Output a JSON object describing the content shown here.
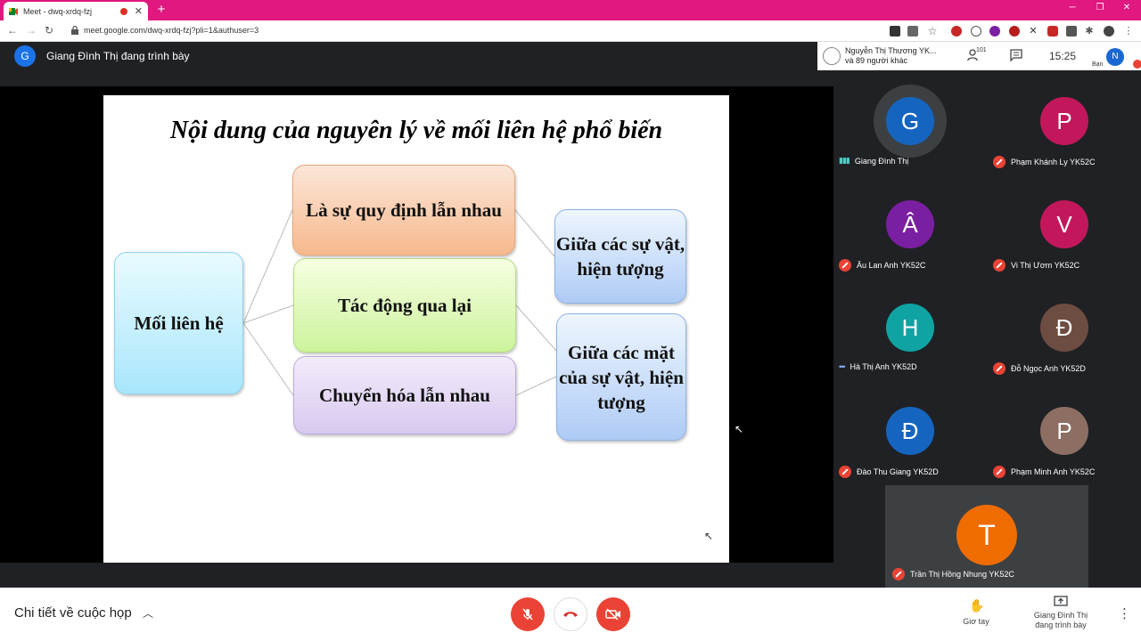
{
  "browser": {
    "tab_title": "Meet - dwq-xrdq-fzj",
    "url": "meet.google.com/dwq-xrdq-fzj?pli=1&authuser=3",
    "new_tab": "+",
    "close_tab": "✕"
  },
  "meet": {
    "presenter": {
      "avatar_letter": "G",
      "label": "Giang Đình Thị đang trình bày"
    },
    "top": {
      "participant_name": "Nguyễn Thị Thương YK...",
      "participant_others": "và 89 người khác",
      "people_count": "101",
      "time": "15:25",
      "me_letter": "N",
      "me_label": "Bạn"
    },
    "participants": [
      {
        "letter": "G",
        "name": "Giang Đình Thị",
        "color": "#1565c0",
        "muted": false,
        "speaking": true
      },
      {
        "letter": "P",
        "name": "Phạm Khánh Ly YK52C",
        "color": "#c2185b",
        "muted": true
      },
      {
        "letter": "Â",
        "name": "Âu Lan Anh YK52C",
        "color": "#7b1fa2",
        "muted": true
      },
      {
        "letter": "V",
        "name": "Vi Thị Ươm YK52C",
        "color": "#c2185b",
        "muted": true
      },
      {
        "letter": "H",
        "name": "Hà Thị Anh YK52D",
        "color": "#0fa3a3",
        "muted": false,
        "speaking": true
      },
      {
        "letter": "Đ",
        "name": "Đỗ Ngọc Anh YK52D",
        "color": "#6d4c41",
        "muted": true
      },
      {
        "letter": "Đ",
        "name": "Đào Thu Giang YK52D",
        "color": "#1565c0",
        "muted": true
      },
      {
        "letter": "P",
        "name": "Phạm Minh Anh YK52C",
        "color": "#8d6e63",
        "muted": true
      }
    ],
    "self_tile": {
      "letter": "T",
      "name": "Trần Thị Hồng Nhung YK52C",
      "color": "#ef6c00"
    },
    "bottom": {
      "details": "Chi tiết về cuộc họp",
      "raise_hand": "Giơ tay",
      "present_now": "Giang Đình Thị đang trình bày"
    }
  },
  "slide": {
    "title": "Nội dung của nguyên lý về mối liên hệ phổ biến",
    "main": "Mối liên hệ",
    "middle": [
      "Là sự quy định lẫn nhau",
      "Tác động qua lại",
      "Chuyển hóa lẫn nhau"
    ],
    "right": [
      "Giữa các sự vật, hiện tượng",
      "Giữa các mặt của sự vật, hiện tượng"
    ]
  },
  "colors": {
    "tabbar": "#e0187f",
    "meet_bg": "#202124",
    "danger": "#ea4335"
  }
}
